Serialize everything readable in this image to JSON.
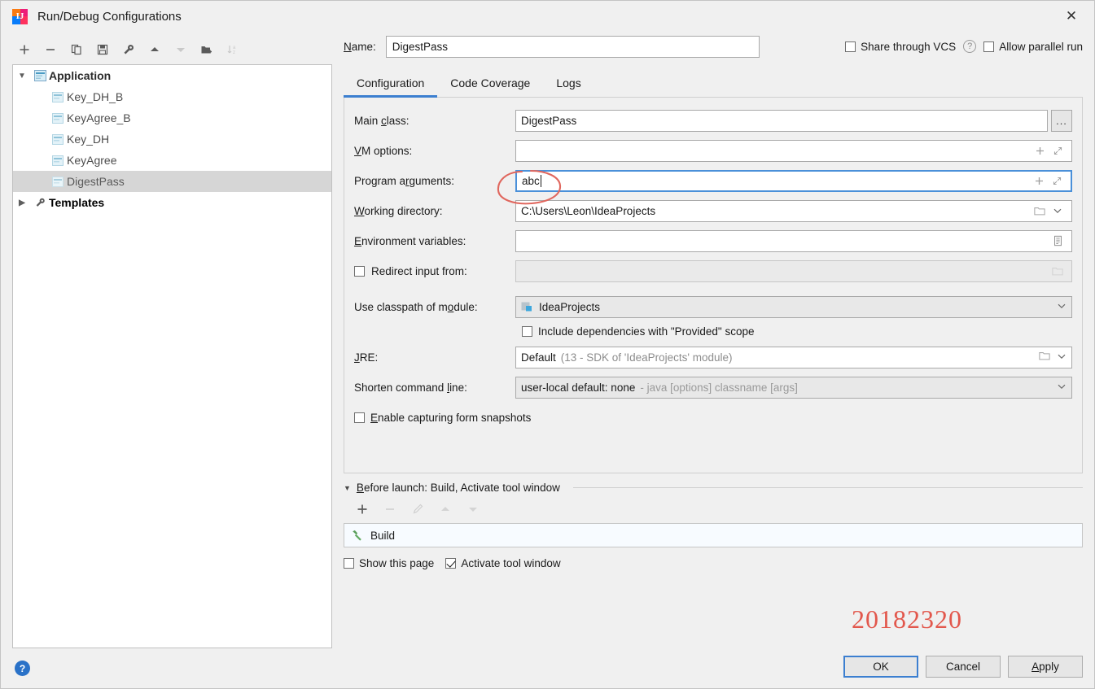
{
  "window": {
    "title": "Run/Debug Configurations",
    "app_icon": "intellij-idea-icon",
    "close_icon": "close-icon"
  },
  "toolbar": {
    "buttons": [
      {
        "name": "add-configuration-button",
        "glyph": "+",
        "disabled": false
      },
      {
        "name": "remove-configuration-button",
        "glyph": "−",
        "disabled": false
      },
      {
        "name": "copy-configuration-button",
        "glyph": "copy-icon",
        "disabled": false
      },
      {
        "name": "save-configuration-button",
        "glyph": "save-icon",
        "disabled": false
      },
      {
        "name": "edit-templates-button",
        "glyph": "wrench-icon",
        "disabled": false
      },
      {
        "name": "move-up-button",
        "glyph": "▲",
        "disabled": false
      },
      {
        "name": "move-down-button",
        "glyph": "▼",
        "disabled": true
      },
      {
        "name": "create-folder-button",
        "glyph": "folder-add-icon",
        "disabled": false
      },
      {
        "name": "sort-configurations-button",
        "glyph": "sort-az-icon",
        "disabled": true
      }
    ]
  },
  "tree": {
    "nodes": [
      {
        "label": "Application",
        "level": 0,
        "type": "root",
        "expanded": true,
        "selected": false,
        "icon": "application-icon"
      },
      {
        "label": "Key_DH_B",
        "level": 1,
        "type": "child",
        "selected": false,
        "icon": "run-config-icon"
      },
      {
        "label": "KeyAgree_B",
        "level": 1,
        "type": "child",
        "selected": false,
        "icon": "run-config-icon"
      },
      {
        "label": "Key_DH",
        "level": 1,
        "type": "child",
        "selected": false,
        "icon": "run-config-icon"
      },
      {
        "label": "KeyAgree",
        "level": 1,
        "type": "child",
        "selected": false,
        "icon": "run-config-icon"
      },
      {
        "label": "DigestPass",
        "level": 1,
        "type": "child",
        "selected": true,
        "icon": "run-config-icon"
      },
      {
        "label": "Templates",
        "level": 0,
        "type": "root",
        "expanded": false,
        "selected": false,
        "icon": "wrench-icon"
      }
    ]
  },
  "header": {
    "name_label": "Name:",
    "name_value": "DigestPass",
    "name_placeholder": "",
    "share_vcs_label": "Share through VCS",
    "share_vcs_checked": false,
    "help_icon": "question-mark-icon",
    "allow_parallel_label": "Allow parallel run",
    "allow_parallel_checked": false
  },
  "tabs": [
    {
      "label": "Configuration",
      "active": true
    },
    {
      "label": "Code Coverage",
      "active": false
    },
    {
      "label": "Logs",
      "active": false
    }
  ],
  "form": {
    "main_class": {
      "label": "Main class:",
      "value": "DigestPass",
      "browse_label": "...",
      "browse_icon": "ellipsis-icon"
    },
    "vm_options": {
      "label": "VM options:",
      "value": "",
      "add_icon": "plus-icon",
      "expand_icon": "expand-icon"
    },
    "program_arguments": {
      "label": "Program arguments:",
      "value": "abc",
      "focused": true,
      "add_icon": "plus-icon",
      "expand_icon": "expand-icon"
    },
    "working_directory": {
      "label": "Working directory:",
      "value": "C:\\Users\\Leon\\IdeaProjects",
      "folder_icon": "folder-icon",
      "chevron_icon": "chevron-down-icon"
    },
    "environment_variables": {
      "label": "Environment variables:",
      "value": "",
      "editor_icon": "list-editor-icon"
    },
    "redirect_input": {
      "label": "Redirect input from:",
      "checked": false,
      "value": "",
      "disabled": true,
      "folder_icon": "folder-icon"
    },
    "classpath_module": {
      "label": "Use classpath of module:",
      "value": "IdeaProjects",
      "module_icon": "module-icon",
      "chevron_icon": "chevron-down-icon"
    },
    "include_provided": {
      "label": "Include dependencies with \"Provided\" scope",
      "checked": false
    },
    "jre": {
      "label": "JRE:",
      "value": "Default",
      "value_hint": "(13 - SDK of 'IdeaProjects' module)",
      "folder_icon": "folder-icon",
      "chevron_icon": "chevron-down-icon"
    },
    "shorten_command_line": {
      "label": "Shorten command line:",
      "value": "user-local default: none",
      "value_hint": "- java [options] classname [args]",
      "chevron_icon": "chevron-down-icon"
    },
    "form_snapshots": {
      "label": "Enable capturing form snapshots",
      "checked": false
    }
  },
  "before_launch": {
    "triangle_icon": "triangle-down-icon",
    "title": "Before launch: Build, Activate tool window",
    "tools": [
      {
        "name": "add-task-button",
        "glyph": "+",
        "disabled": false
      },
      {
        "name": "remove-task-button",
        "glyph": "−",
        "disabled": true
      },
      {
        "name": "edit-task-button",
        "glyph": "pencil-icon",
        "disabled": true
      },
      {
        "name": "move-task-up-button",
        "glyph": "▲",
        "disabled": true
      },
      {
        "name": "move-task-down-button",
        "glyph": "▼",
        "disabled": true
      }
    ],
    "items": [
      {
        "label": "Build",
        "icon": "hammer-icon"
      }
    ],
    "show_page_label": "Show this page",
    "show_page_checked": false,
    "activate_tool_window_label": "Activate tool window",
    "activate_tool_window_checked": true
  },
  "annotation": {
    "watermark": "20182320",
    "watermark_color": "#e2574c",
    "circle_color": "#e0675e"
  },
  "footer": {
    "help_icon": "help-icon",
    "ok_label": "OK",
    "cancel_label": "Cancel",
    "apply_label": "Apply"
  }
}
